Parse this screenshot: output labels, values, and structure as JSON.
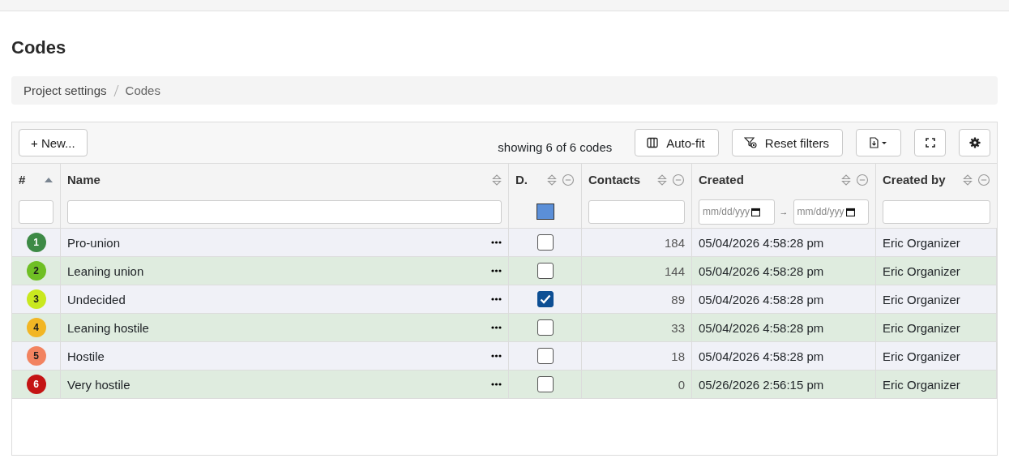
{
  "page_title": "Codes",
  "breadcrumb": [
    "Project settings",
    "Codes"
  ],
  "toolbar": {
    "new_button": "+ New...",
    "summary": "showing 6 of 6 codes",
    "autofit_button": "Auto-fit",
    "reset_button": "Reset filters"
  },
  "table": {
    "columns": [
      "#",
      "Name",
      "D.",
      "Contacts",
      "Created",
      "Created by"
    ],
    "date_placeholders": [
      "mm/dd/yyy",
      "mm/dd/yyy"
    ],
    "date_separator": "→",
    "d_filter": {
      "indeterminate": true
    },
    "rows": [
      {
        "number": "1",
        "color": "#3d8a46",
        "name": "Pro-union",
        "checked": false,
        "contacts": "184",
        "created": "05/04/2026 4:58:28 pm",
        "created_by": "Eric Organizer"
      },
      {
        "number": "2",
        "color": "#6fbf24",
        "name": "Leaning union",
        "checked": false,
        "contacts": "144",
        "created": "05/04/2026 4:58:28 pm",
        "created_by": "Eric Organizer"
      },
      {
        "number": "3",
        "color": "#c9e81f",
        "name": "Undecided",
        "checked": true,
        "contacts": "89",
        "created": "05/04/2026 4:58:28 pm",
        "created_by": "Eric Organizer"
      },
      {
        "number": "4",
        "color": "#f2b624",
        "name": "Leaning hostile",
        "checked": false,
        "contacts": "33",
        "created": "05/04/2026 4:58:28 pm",
        "created_by": "Eric Organizer"
      },
      {
        "number": "5",
        "color": "#f28360",
        "name": "Hostile",
        "checked": false,
        "contacts": "18",
        "created": "05/04/2026 4:58:28 pm",
        "created_by": "Eric Organizer"
      },
      {
        "number": "6",
        "color": "#c41414",
        "name": "Very hostile",
        "checked": false,
        "contacts": "0",
        "created": "05/26/2026 2:56:15 pm",
        "created_by": "Eric Organizer"
      }
    ]
  }
}
